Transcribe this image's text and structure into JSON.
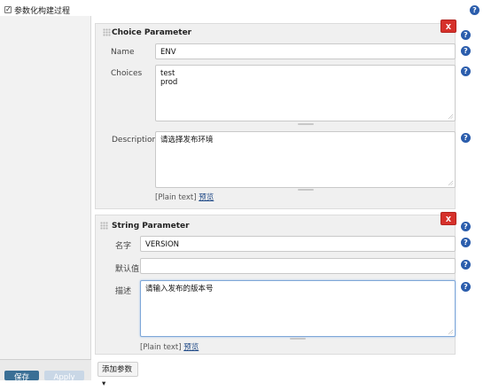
{
  "header": {
    "checkbox_label": "参数化构建过程",
    "checked": true
  },
  "choice_parameter": {
    "title": "Choice Parameter",
    "delete_label": "X",
    "name_label": "Name",
    "name_value": "ENV",
    "choices_label": "Choices",
    "choices_value": "test\nprod",
    "description_label": "Description",
    "description_value": "请选择发布环境",
    "plain_text": "[Plain text]",
    "preview_link": "预览"
  },
  "string_parameter": {
    "title": "String Parameter",
    "delete_label": "X",
    "name_label": "名字",
    "name_value": "VERSION",
    "default_label": "默认值",
    "default_value": "",
    "description_label": "描述",
    "description_value": "请输入发布的版本号",
    "plain_text": "[Plain text]",
    "preview_link": "预览"
  },
  "footer": {
    "add_parameter_label": "添加参数",
    "dropdown_caret": "▾",
    "save_label": "保存",
    "apply_label": "Apply"
  },
  "icons": {
    "help": "?",
    "check": "✓"
  },
  "colors": {
    "delete_button": "#d6312b",
    "link": "#204a87",
    "help_icon": "#2b5dac",
    "save_button": "#3a6f95"
  }
}
